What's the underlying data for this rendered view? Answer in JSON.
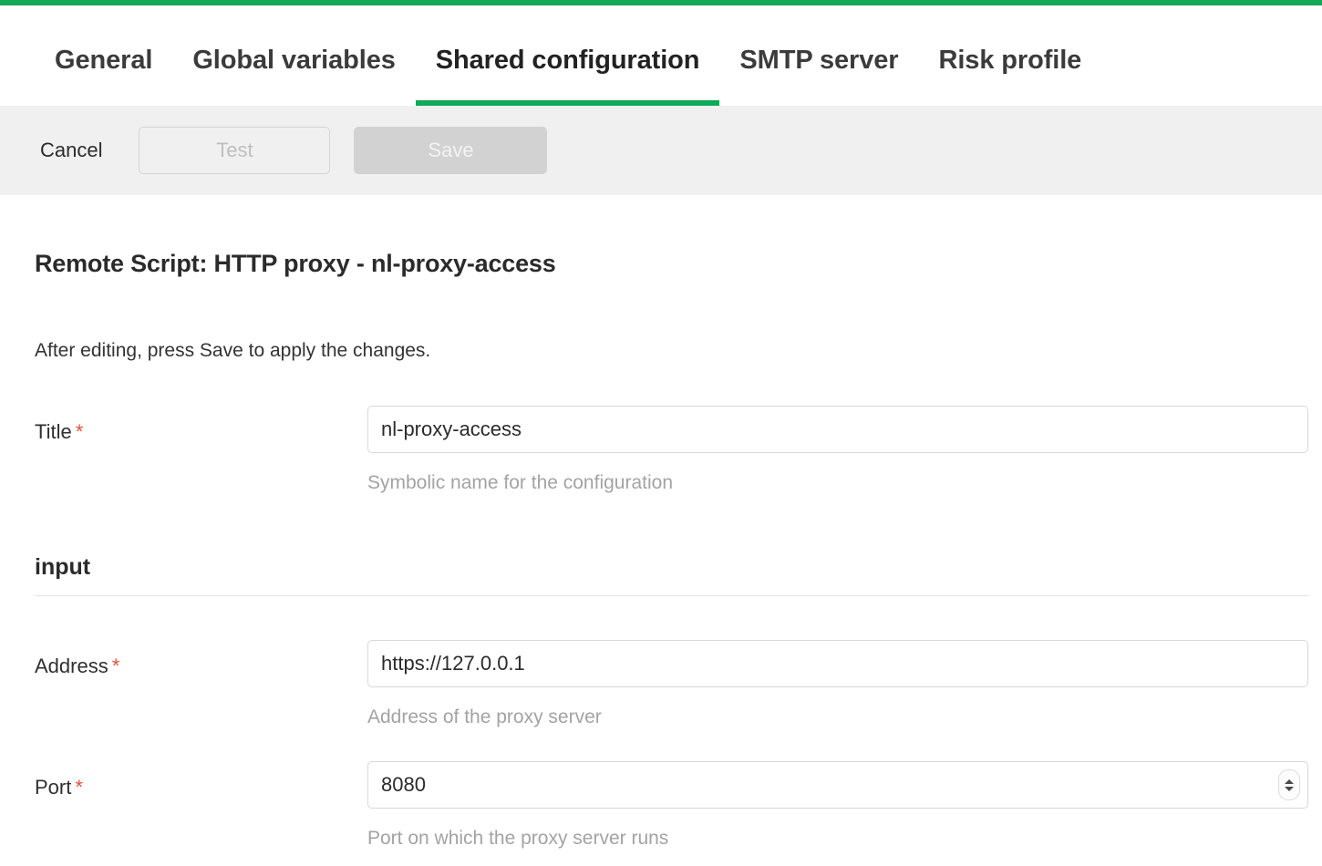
{
  "theme": {
    "accent_green": "#0fa958",
    "required_star_color": "#e8503a",
    "toolbar_bg": "#f0f0f0",
    "helper_text_color": "#a3a3a3"
  },
  "tabs": [
    {
      "label": "General",
      "active": false
    },
    {
      "label": "Global variables",
      "active": false
    },
    {
      "label": "Shared configuration",
      "active": true
    },
    {
      "label": "SMTP server",
      "active": false
    },
    {
      "label": "Risk profile",
      "active": false
    }
  ],
  "toolbar": {
    "cancel_label": "Cancel",
    "test_label": "Test",
    "save_label": "Save"
  },
  "page": {
    "title": "Remote Script: HTTP proxy - nl-proxy-access",
    "subtitle": "After editing, press Save to apply the changes."
  },
  "fields": {
    "title": {
      "label": "Title",
      "required_marker": "*",
      "value": "nl-proxy-access",
      "placeholder": "",
      "helper": "Symbolic name for the configuration"
    },
    "address": {
      "label": "Address",
      "required_marker": "*",
      "value": "https://127.0.0.1",
      "placeholder": "",
      "helper": "Address of the proxy server"
    },
    "port": {
      "label": "Port",
      "required_marker": "*",
      "value": "8080",
      "placeholder": "",
      "helper": "Port on which the proxy server runs"
    }
  },
  "sections": {
    "input": {
      "title": "input"
    }
  }
}
